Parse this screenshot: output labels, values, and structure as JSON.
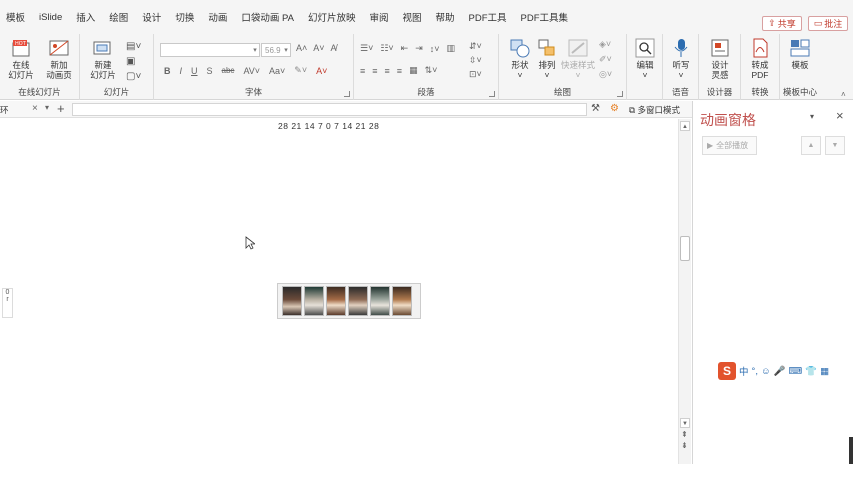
{
  "menu": {
    "items": [
      "模板",
      "iSlide",
      "插入",
      "绘图",
      "设计",
      "切换",
      "动画",
      "口袋动画 PA",
      "幻灯片放映",
      "审阅",
      "视图",
      "帮助",
      "PDF工具",
      "PDF工具集"
    ],
    "share_label": "共享",
    "comment_label": "批注"
  },
  "ribbon": {
    "online_slides": {
      "btn1": "在线\n幻灯片",
      "btn2": "新加\n动画页",
      "label": "在线幻灯片",
      "hot": "HOT"
    },
    "slides": {
      "new_slide": "新建\n幻灯片",
      "label": "幻灯片"
    },
    "font": {
      "font_name": "",
      "font_size": "56.9",
      "bold": "B",
      "italic": "I",
      "underline": "U",
      "shadow": "S",
      "strike": "abc",
      "label": "字体"
    },
    "paragraph": {
      "label": "段落"
    },
    "drawing": {
      "shape": "形状",
      "arrange": "排列",
      "quick_style": "快速样式",
      "label": "绘图"
    },
    "edit": {
      "label": "编辑"
    },
    "voice": {
      "dictate": "听写",
      "label": "语音"
    },
    "designer": {
      "design": "设计\n灵感",
      "label": "设计器"
    },
    "convert": {
      "pdf": "转成\nPDF",
      "label": "转换"
    },
    "template": {
      "tpl": "模板",
      "label": "模板中心"
    }
  },
  "tabstrip": {
    "tab_name": "环",
    "multiwindow_label": "多窗口模式"
  },
  "ruler": {
    "labels": "28  21  14   7    0    7   14  21  28"
  },
  "vruler": {
    "label": "0"
  },
  "anipane": {
    "title": "动画窗格",
    "play_all": "全部播放"
  },
  "ime": {
    "logo": "S",
    "items": [
      "中",
      "°,",
      "☺",
      "🎤",
      "⌨",
      "👕",
      "▦"
    ]
  },
  "colors": {
    "accent": "#c0504d",
    "brand": "#d24726"
  }
}
